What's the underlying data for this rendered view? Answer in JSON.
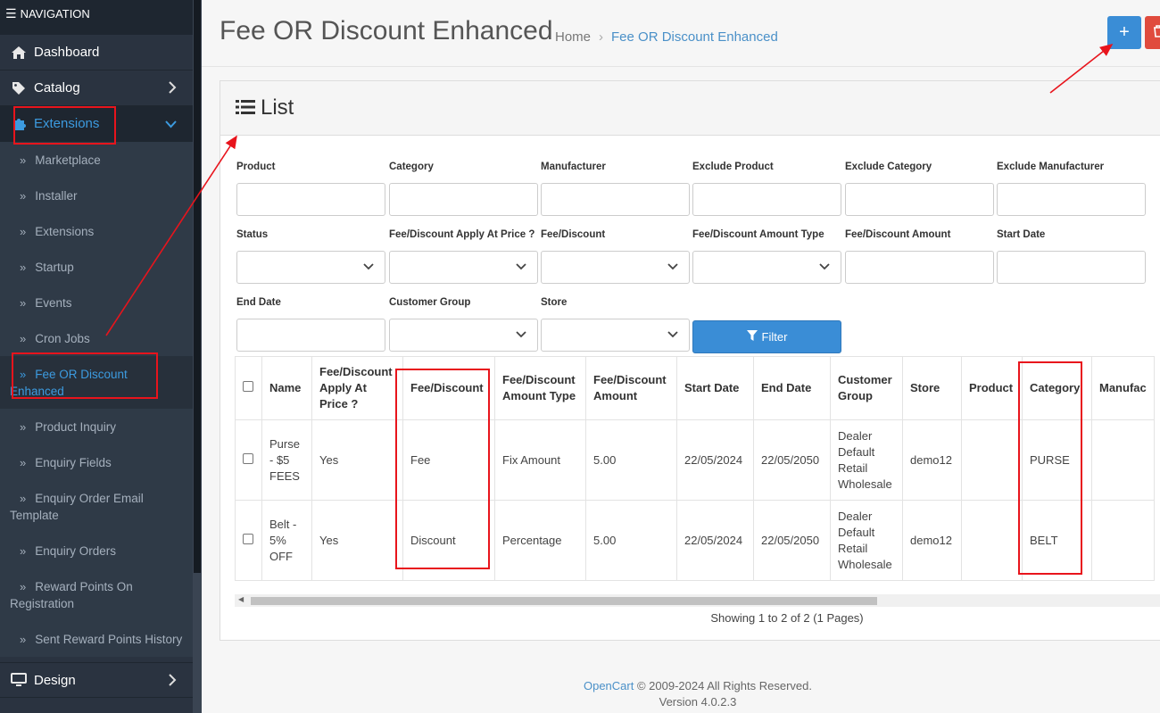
{
  "nav": {
    "header": "NAVIGATION",
    "top_items": [
      {
        "label": "Dashboard"
      },
      {
        "label": "Catalog"
      },
      {
        "label": "Extensions"
      }
    ],
    "sub_items": [
      "Marketplace",
      "Installer",
      "Extensions",
      "Startup",
      "Events",
      "Cron Jobs",
      "Fee OR Discount Enhanced",
      "Product Inquiry",
      "Enquiry Fields",
      "Enquiry Order Email Template",
      "Enquiry Orders",
      "Reward Points On Registration",
      "Sent Reward Points History"
    ],
    "bottom_items": [
      {
        "label": "Design"
      }
    ]
  },
  "header": {
    "title": "Fee OR Discount Enhanced",
    "breadcrumb": [
      "Home",
      "Fee OR Discount Enhanced"
    ],
    "add_symbol": "+"
  },
  "card": {
    "title": "List"
  },
  "filters": {
    "labels": [
      "Product",
      "Category",
      "Manufacturer",
      "Exclude Product",
      "Exclude Category",
      "Exclude Manufacturer",
      "Status",
      "Fee/Discount Apply At Price ?",
      "Fee/Discount",
      "Fee/Discount Amount Type",
      "Fee/Discount Amount",
      "Start Date",
      "End Date",
      "Customer Group",
      "Store"
    ],
    "button": "Filter"
  },
  "table": {
    "headers": [
      "Name",
      "Fee/Discount Apply At Price ?",
      "Fee/Discount",
      "Fee/Discount Amount Type",
      "Fee/Discount Amount",
      "Start Date",
      "End Date",
      "Customer Group",
      "Store",
      "Product",
      "Category",
      "Manufac"
    ],
    "rows": [
      [
        "Purse - $5 FEES",
        "Yes",
        "Fee",
        "Fix Amount",
        "5.00",
        "22/05/2024",
        "22/05/2050",
        "Dealer Default Retail Wholesale",
        "demo12",
        "",
        "PURSE",
        ""
      ],
      [
        "Belt - 5% OFF",
        "Yes",
        "Discount",
        "Percentage",
        "5.00",
        "22/05/2024",
        "22/05/2050",
        "Dealer Default Retail Wholesale",
        "demo12",
        "",
        "BELT",
        ""
      ]
    ]
  },
  "pagination": {
    "text": "Showing 1 to 2 of 2 (1 Pages)"
  },
  "footer": {
    "brand": "OpenCart",
    "copyright": " © 2009-2024 All Rights Reserved.",
    "version": "Version 4.0.2.3"
  },
  "colors": {
    "primary": "#3a8dd6",
    "danger": "#e04b3d",
    "sidebar": "#2a3340",
    "annotation": "#e8141c"
  }
}
